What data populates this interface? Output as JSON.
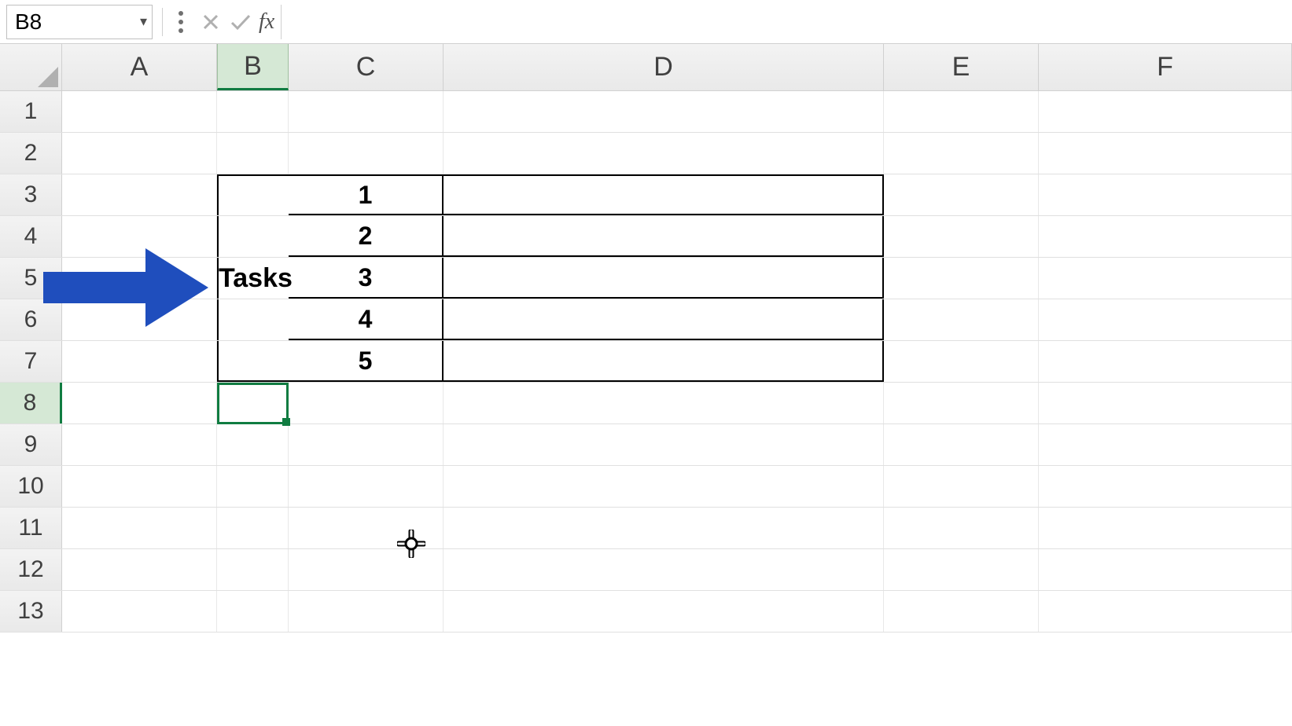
{
  "formula_bar": {
    "name_box": "B8",
    "formula_value": ""
  },
  "columns": [
    "A",
    "B",
    "C",
    "D",
    "E",
    "F"
  ],
  "rows": [
    "1",
    "2",
    "3",
    "4",
    "5",
    "6",
    "7",
    "8",
    "9",
    "10",
    "11",
    "12",
    "13"
  ],
  "active_column": "B",
  "active_row": "8",
  "cells": {
    "B5": "Tasks",
    "C3": "1",
    "C4": "2",
    "C5": "3",
    "C6": "4",
    "C7": "5"
  },
  "selection": {
    "cell": "B8"
  },
  "arrow_color": "#1f4ebd"
}
